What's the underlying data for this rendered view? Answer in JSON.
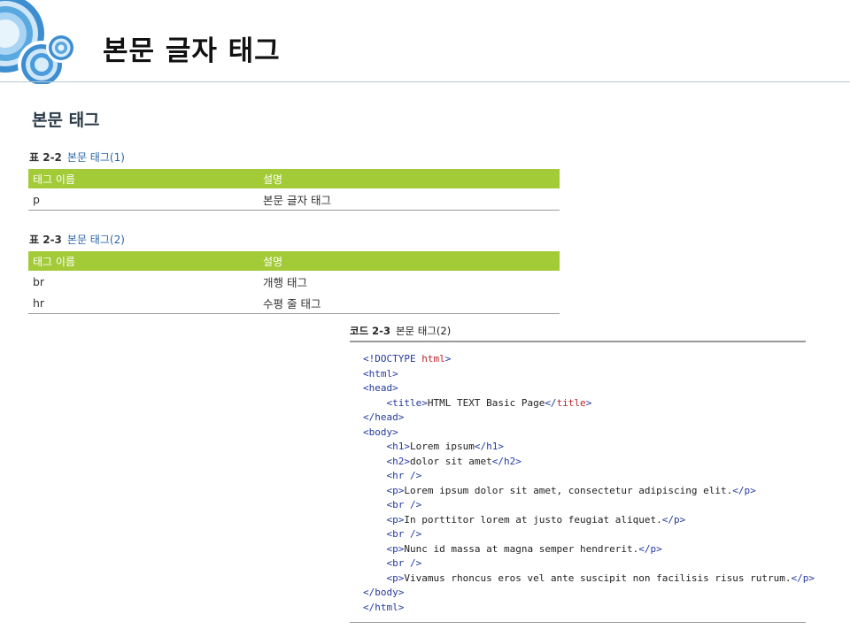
{
  "slide": {
    "title": "본문 글자 태그"
  },
  "section": {
    "heading": "본문 태그"
  },
  "table1": {
    "number": "표 2-2",
    "caption": "본문 태그(1)",
    "headers": [
      "태그 이름",
      "설명"
    ],
    "rows": [
      [
        "p",
        "본문 글자 태그"
      ]
    ]
  },
  "table2": {
    "number": "표 2-3",
    "caption": "본문 태그(2)",
    "headers": [
      "태그 이름",
      "설명"
    ],
    "rows": [
      [
        "br",
        "개행 태그"
      ],
      [
        "hr",
        "수평 줄 태그"
      ]
    ]
  },
  "code": {
    "number": "코드 2-3",
    "caption": "본문 태그(2)",
    "lines": [
      [
        [
          "t",
          "<!DOCTYPE "
        ],
        [
          "k",
          "html"
        ],
        [
          "t",
          ">"
        ]
      ],
      [
        [
          "t",
          "<html>"
        ]
      ],
      [
        [
          "t",
          "<head>"
        ]
      ],
      [
        [
          "p",
          "    "
        ],
        [
          "t",
          "<title>"
        ],
        [
          "p",
          "HTML TEXT Basic Page"
        ],
        [
          "t",
          "</"
        ],
        [
          "k",
          "title"
        ],
        [
          "t",
          ">"
        ]
      ],
      [
        [
          "t",
          "</head>"
        ]
      ],
      [
        [
          "t",
          "<body>"
        ]
      ],
      [
        [
          "p",
          "    "
        ],
        [
          "t",
          "<h1>"
        ],
        [
          "p",
          "Lorem ipsum"
        ],
        [
          "t",
          "</h1>"
        ]
      ],
      [
        [
          "p",
          "    "
        ],
        [
          "t",
          "<h2>"
        ],
        [
          "p",
          "dolor sit amet"
        ],
        [
          "t",
          "</h2>"
        ]
      ],
      [
        [
          "p",
          "    "
        ],
        [
          "t",
          "<hr />"
        ]
      ],
      [
        [
          "p",
          "    "
        ],
        [
          "t",
          "<p>"
        ],
        [
          "p",
          "Lorem ipsum dolor sit amet, consectetur adipiscing elit."
        ],
        [
          "t",
          "</p>"
        ]
      ],
      [
        [
          "p",
          "    "
        ],
        [
          "t",
          "<br />"
        ]
      ],
      [
        [
          "p",
          "    "
        ],
        [
          "t",
          "<p>"
        ],
        [
          "p",
          "In porttitor lorem at justo feugiat aliquet."
        ],
        [
          "t",
          "</p>"
        ]
      ],
      [
        [
          "p",
          "    "
        ],
        [
          "t",
          "<br />"
        ]
      ],
      [
        [
          "p",
          "    "
        ],
        [
          "t",
          "<p>"
        ],
        [
          "p",
          "Nunc id massa at magna semper hendrerit."
        ],
        [
          "t",
          "</p>"
        ]
      ],
      [
        [
          "p",
          "    "
        ],
        [
          "t",
          "<br />"
        ]
      ],
      [
        [
          "p",
          "    "
        ],
        [
          "t",
          "<p>"
        ],
        [
          "p",
          "Vivamus rhoncus eros vel ante suscipit non facilisis risus rutrum."
        ],
        [
          "t",
          "</p>"
        ]
      ],
      [
        [
          "t",
          "</body>"
        ]
      ],
      [
        [
          "t",
          "</html>"
        ]
      ]
    ]
  },
  "colors": {
    "table_header": "#a3cb38",
    "caption_title": "#2a64a8",
    "code_tag": "#243a9c",
    "code_keyword": "#b8242a",
    "logo_blue": "#3a8fd0"
  }
}
